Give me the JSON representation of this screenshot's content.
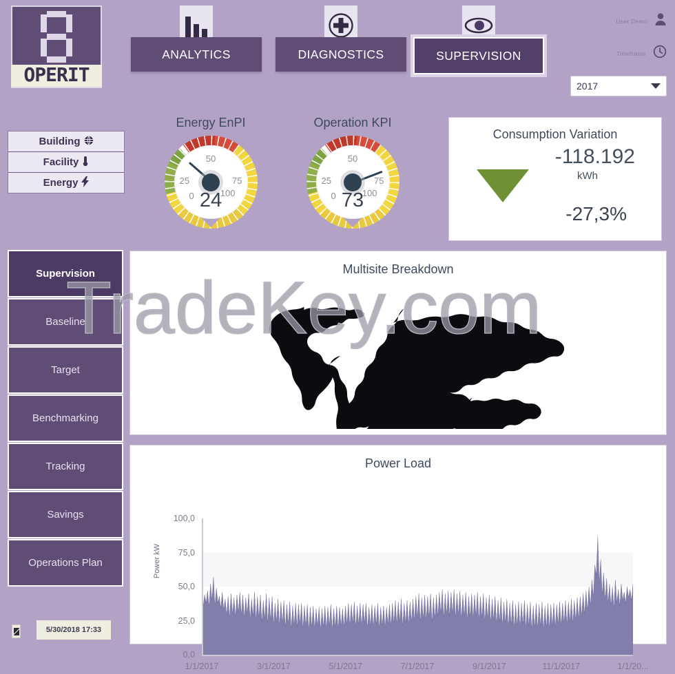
{
  "brand": {
    "logo_text": "OPERIT"
  },
  "topnav": {
    "items": [
      {
        "label": "ANALYTICS",
        "icon": "bar-chart-icon",
        "active": false
      },
      {
        "label": "DIAGNOSTICS",
        "icon": "medical-cross-icon",
        "active": false
      },
      {
        "label": "SUPERVISION",
        "icon": "eye-icon",
        "active": true
      }
    ]
  },
  "account": {
    "user_label": "User Demo",
    "user_icon": "person-icon",
    "timeframe_label": "Timeframe",
    "timeframe_icon": "clock-icon",
    "year_selected": "2017",
    "year_options": [
      "2017"
    ]
  },
  "filters": [
    {
      "label": "Building",
      "icon": "globe-icon"
    },
    {
      "label": "Facility",
      "icon": "thermometer-icon"
    },
    {
      "label": "Energy",
      "icon": "lightning-bolt-icon"
    }
  ],
  "sidebar": {
    "items": [
      {
        "label": "Supervision",
        "active": true
      },
      {
        "label": "Baseline",
        "active": false
      },
      {
        "label": "Target",
        "active": false
      },
      {
        "label": "Benchmarking",
        "active": false
      },
      {
        "label": "Tracking",
        "active": false
      },
      {
        "label": "Savings",
        "active": false
      },
      {
        "label": "Operations Plan",
        "active": false
      }
    ],
    "date_badge": "5/30/2018  17:33"
  },
  "gauges": [
    {
      "title": "Energy EnPI",
      "value": "24",
      "min_label": "0",
      "max_label": "100",
      "ticks": [
        "25",
        "50",
        "75"
      ],
      "needle_deg": 221
    },
    {
      "title": "Operation KPI",
      "value": "73",
      "min_label": "0",
      "max_label": "100",
      "ticks": [
        "25",
        "50",
        "75"
      ],
      "needle_deg": 339
    }
  ],
  "consumption": {
    "title": "Consumption Variation",
    "value": "-118.192",
    "unit": "kWh",
    "percent": "-27,3%",
    "trend_icon": "down-arrow-icon",
    "trend_color": "#6f9134"
  },
  "map_panel": {
    "title": "Multisite Breakdown"
  },
  "watermark": {
    "text": "TradeKey.com"
  },
  "chart_data": {
    "type": "area",
    "title": "Power Load",
    "xlabel": "",
    "ylabel": "Power kW",
    "ylim": [
      0,
      100
    ],
    "yticks": [
      "100,0",
      "75,0",
      "50,0",
      "25,0",
      "0,0"
    ],
    "ytick_values": [
      100,
      75,
      50,
      25,
      0
    ],
    "xticks": [
      "1/1/2017",
      "3/1/2017",
      "5/1/2017",
      "7/1/2017",
      "9/1/2017",
      "11/1/2017",
      "1/1/20..."
    ],
    "grid": true,
    "series_color": "#7b77a6",
    "series": [
      {
        "name": "Power kW",
        "values": [
          36,
          44,
          38,
          47,
          35,
          52,
          40,
          57,
          36,
          49,
          38,
          43,
          34,
          46,
          33,
          41,
          29,
          43,
          27,
          45,
          30,
          42,
          28,
          44,
          31,
          46,
          29,
          44,
          27,
          42,
          30,
          45,
          26,
          41,
          28,
          46,
          25,
          43,
          27,
          44,
          24,
          40,
          26,
          45,
          23,
          42,
          25,
          43,
          22,
          38,
          24,
          41,
          21,
          39,
          23,
          40,
          20,
          37,
          22,
          39,
          19,
          36,
          21,
          38,
          20,
          37,
          22,
          38,
          19,
          36,
          21,
          37,
          18,
          35,
          20,
          36,
          19,
          34,
          21,
          35,
          18,
          34,
          20,
          36,
          19,
          35,
          21,
          37,
          18,
          34,
          20,
          36,
          19,
          35,
          21,
          34,
          20,
          36,
          22,
          38,
          21,
          37,
          23,
          39,
          20,
          36,
          22,
          38,
          21,
          37,
          23,
          38,
          19,
          35,
          21,
          37,
          20,
          36,
          22,
          38,
          19,
          35,
          21,
          36,
          20,
          35,
          22,
          37,
          21,
          38,
          23,
          40,
          22,
          39,
          24,
          41,
          21,
          38,
          23,
          40,
          22,
          39,
          24,
          41,
          25,
          43,
          27,
          45,
          24,
          42,
          26,
          44,
          25,
          43,
          27,
          45,
          24,
          42,
          26,
          44,
          28,
          46,
          30,
          48,
          27,
          45,
          29,
          47,
          28,
          46,
          30,
          48,
          27,
          45,
          29,
          47,
          26,
          44,
          28,
          46,
          25,
          43,
          27,
          45,
          26,
          44,
          28,
          46,
          25,
          43,
          27,
          45,
          24,
          42,
          26,
          44,
          23,
          41,
          25,
          43,
          22,
          40,
          24,
          42,
          21,
          39,
          23,
          41,
          20,
          38,
          22,
          40,
          19,
          37,
          21,
          39,
          20,
          38,
          22,
          40,
          19,
          37,
          21,
          39,
          18,
          36,
          20,
          38,
          19,
          37,
          21,
          39,
          18,
          36,
          20,
          38,
          19,
          37,
          21,
          38,
          20,
          37,
          22,
          39,
          21,
          38,
          23,
          40,
          22,
          39,
          24,
          41,
          23,
          40,
          25,
          42,
          26,
          43,
          28,
          45,
          30,
          47,
          32,
          50,
          36,
          55,
          42,
          66,
          58,
          87,
          52,
          70,
          44,
          60,
          40,
          56,
          38,
          52,
          36,
          50,
          34,
          55,
          38,
          48,
          36,
          52,
          40,
          46,
          38,
          50,
          42,
          48,
          40,
          52
        ]
      }
    ]
  }
}
